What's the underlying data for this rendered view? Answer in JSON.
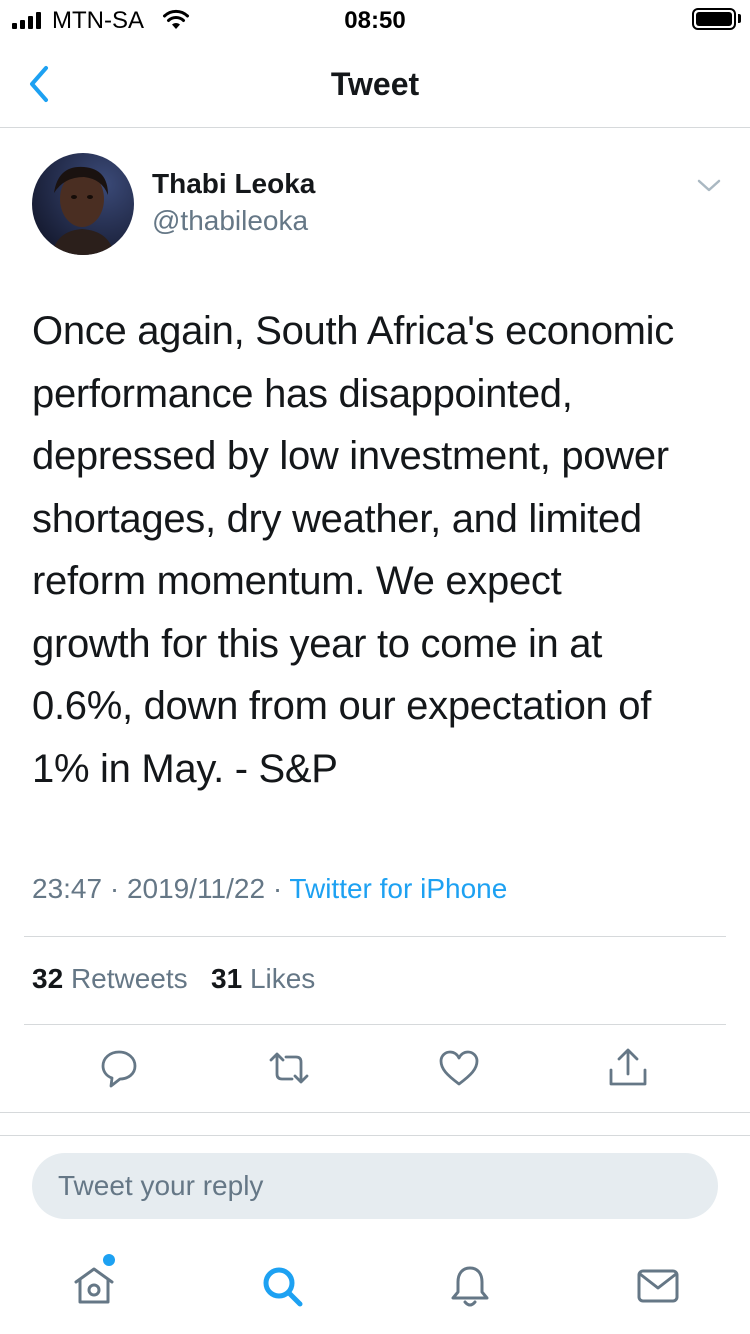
{
  "status_bar": {
    "carrier": "MTN-SA",
    "time": "08:50",
    "icons": [
      "signal-icon",
      "wifi-icon",
      "battery-icon"
    ]
  },
  "nav": {
    "title": "Tweet",
    "back_icon": "chevron-left-icon"
  },
  "tweet": {
    "author_name": "Thabi Leoka",
    "author_handle": "@thabileoka",
    "text_lines": [
      "Once again, South Africa's economic",
      "performance has disappointed,",
      "depressed by low investment, power",
      "shortages, dry weather, and limited",
      "reform momentum. We expect",
      "growth for this year to come in at",
      "0.6%, down from our expectation of",
      "1% in May. - S&P"
    ],
    "time": "23:47",
    "sep1": "·",
    "date": "2019/11/22",
    "sep2": "·",
    "source": "Twitter for iPhone",
    "retweets_count": "32",
    "retweets_label": "Retweets",
    "likes_count": "31",
    "likes_label": "Likes"
  },
  "actions": [
    "reply-icon",
    "retweet-icon",
    "like-icon",
    "share-icon"
  ],
  "reply": {
    "placeholder": "Tweet your reply"
  },
  "tab_bar": {
    "items": [
      "home-icon",
      "search-icon",
      "notifications-icon",
      "messages-icon"
    ]
  },
  "colors": {
    "accent": "#1da1f2",
    "text_primary": "#14171a",
    "text_secondary": "#657786",
    "divider": "#d6d9db",
    "reply_bg": "#e6ecf0"
  }
}
